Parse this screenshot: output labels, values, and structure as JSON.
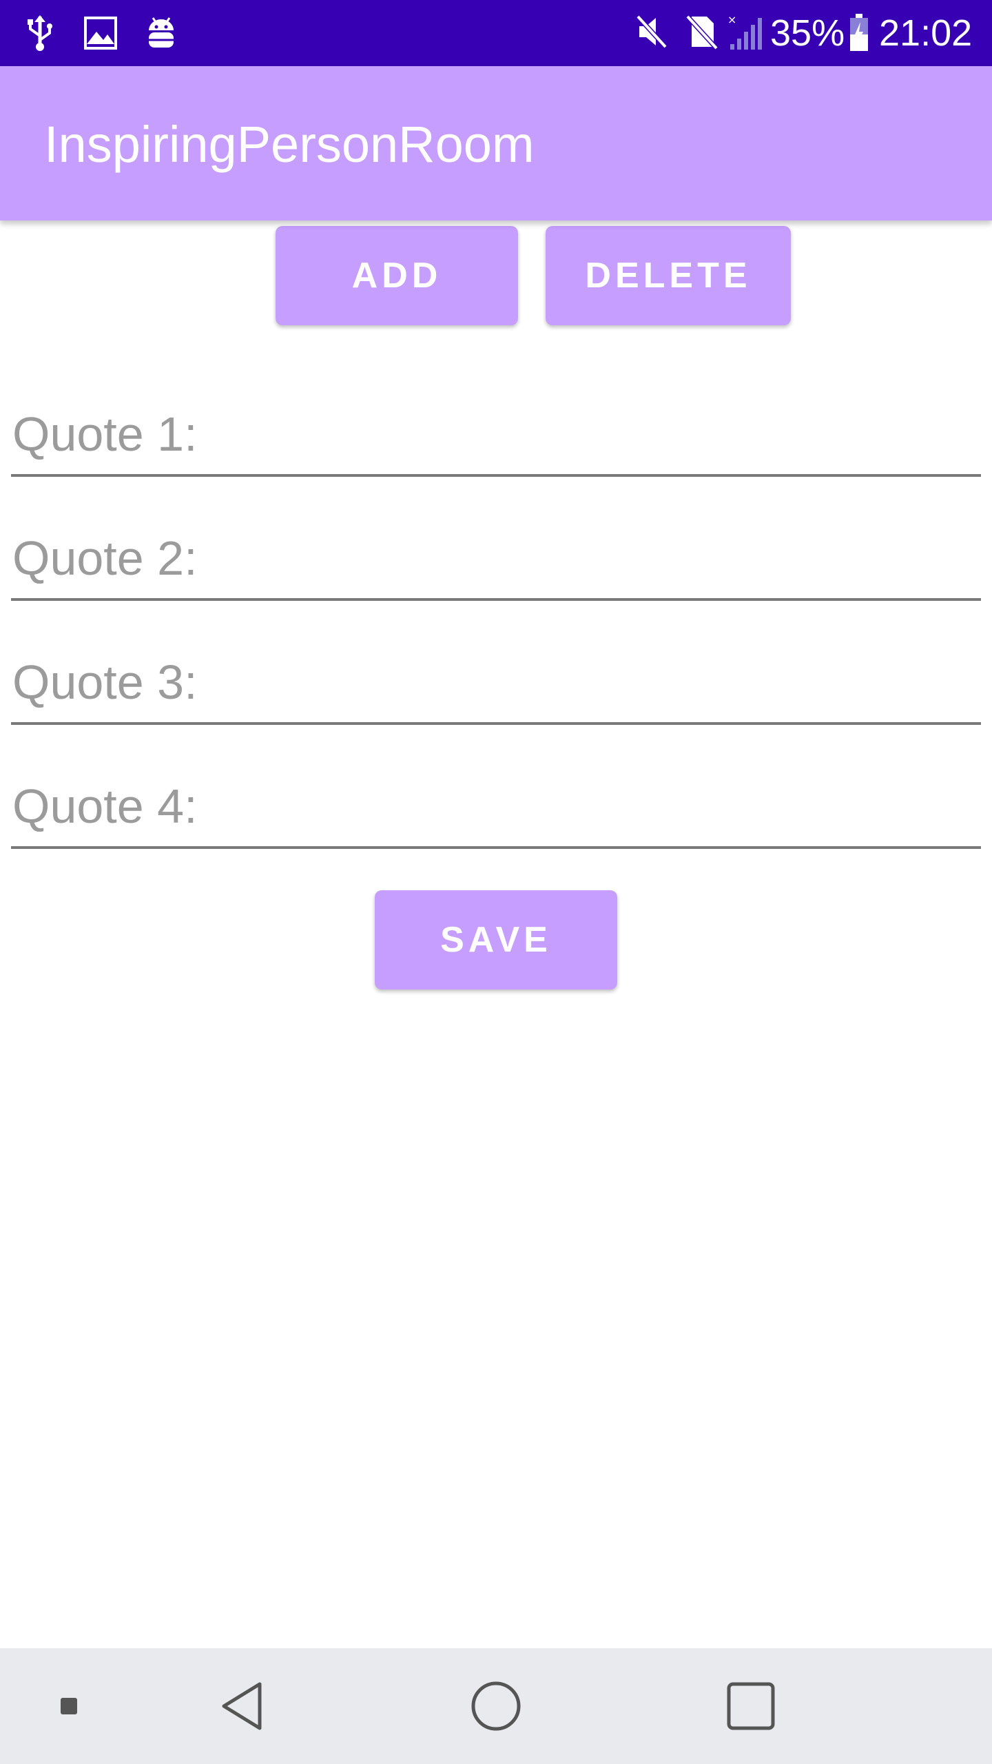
{
  "status_bar": {
    "icons_left": [
      "usb-icon",
      "image-icon",
      "android-debug-icon"
    ],
    "icons_right": [
      "mute-icon",
      "no-sim-icon",
      "signal-icon",
      "battery-charging-icon"
    ],
    "battery": "35%",
    "time": "21:02"
  },
  "app_bar": {
    "title": "InspiringPersonRoom"
  },
  "actions": {
    "add_label": "ADD",
    "delete_label": "DELETE",
    "save_label": "SAVE"
  },
  "quotes": [
    {
      "placeholder": "Quote 1:",
      "value": ""
    },
    {
      "placeholder": "Quote 2:",
      "value": ""
    },
    {
      "placeholder": "Quote 3:",
      "value": ""
    },
    {
      "placeholder": "Quote 4:",
      "value": ""
    }
  ],
  "nav_bar": {
    "buttons": [
      "small-square-icon",
      "back-icon",
      "home-icon",
      "recents-icon"
    ]
  },
  "colors": {
    "status_bar": "#3700b3",
    "primary": "#c69eff",
    "nav_bar": "#e9eaee",
    "hint_text": "#9b9b9b"
  }
}
